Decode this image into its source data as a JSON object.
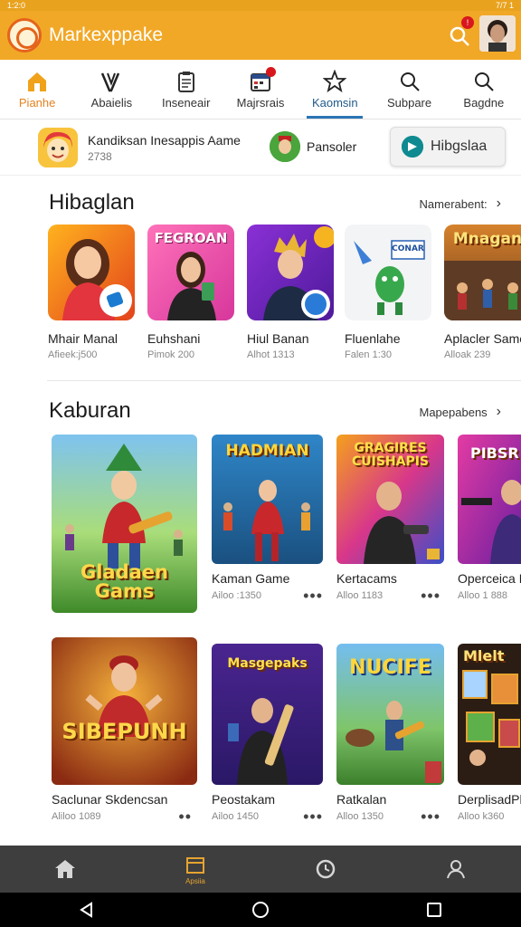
{
  "app": {
    "status_left": "1:2:0",
    "status_right": "7/7 1",
    "title": "Markexppake",
    "notif_count": "!"
  },
  "tabs": [
    {
      "label": "Pianhe",
      "icon": "home-icon",
      "active": false
    },
    {
      "label": "Abaielis",
      "icon": "v-logo-icon",
      "active": false
    },
    {
      "label": "Inseneair",
      "icon": "clipboard-icon",
      "active": false
    },
    {
      "label": "Majrsrais",
      "icon": "calendar-icon",
      "active": false
    },
    {
      "label": "Kaomsin",
      "icon": "star-icon",
      "active": true
    },
    {
      "label": "Subpare",
      "icon": "search-icon",
      "active": false
    },
    {
      "label": "Bagdne",
      "icon": "search-icon",
      "active": false
    }
  ],
  "featured": {
    "title": "Kandiksan Inesappis Aame",
    "count": "2738",
    "secondary_title": "Pansoler",
    "button_label": "Hibgslaa"
  },
  "section1": {
    "title": "Hibaglan",
    "link": "Namerabent:",
    "items": [
      {
        "name": "Mhair Manal",
        "meta": "Afieek:j500",
        "banner": ""
      },
      {
        "name": "Euhshani",
        "meta": "Pimok 200",
        "banner": "FEGROAN"
      },
      {
        "name": "Hiul Banan",
        "meta": "Alhot 1313",
        "banner": ""
      },
      {
        "name": "Fluenlahe",
        "meta": "Falen 1:30",
        "banner": "CONAR"
      },
      {
        "name": "Aplacler Same",
        "meta": "Alloak 239",
        "banner": "Mnagan"
      }
    ]
  },
  "section2": {
    "title": "Kaburan",
    "link": "Mapepabens",
    "row1": [
      {
        "name": "",
        "meta": "",
        "art": "Gladaen Gams"
      },
      {
        "name": "Kaman Game",
        "meta": "Ailoo :1350",
        "art": "HADMIAN"
      },
      {
        "name": "Kertacams",
        "meta": "Alloo 1183",
        "art": "GRAGIRES CUISHAPIS"
      },
      {
        "name": "Operceica E",
        "meta": "Alloo 1 888",
        "art": "PIBSR"
      }
    ],
    "row2": [
      {
        "name": "Saclunar Skdencsan",
        "meta": "Aliloo 1089",
        "art": "SIBEPUNH"
      },
      {
        "name": "Peostakam",
        "meta": "Ailoo 1450",
        "art": "Masgepaks"
      },
      {
        "name": "Ratkalan",
        "meta": "Alloo 1350",
        "art": "NUCIFE"
      },
      {
        "name": "DerplisadPh",
        "meta": "Alloo k360",
        "art": "Mlelt"
      }
    ]
  },
  "bottom_nav": [
    {
      "icon": "home-icon",
      "label": ""
    },
    {
      "icon": "store-icon",
      "label": "Apsiia"
    },
    {
      "icon": "history-icon",
      "label": ""
    },
    {
      "icon": "profile-icon",
      "label": ""
    }
  ],
  "colors": {
    "app_bar": "#f1a827",
    "accent": "#2a75b5",
    "bottom_nav": "#3e3e3e"
  }
}
